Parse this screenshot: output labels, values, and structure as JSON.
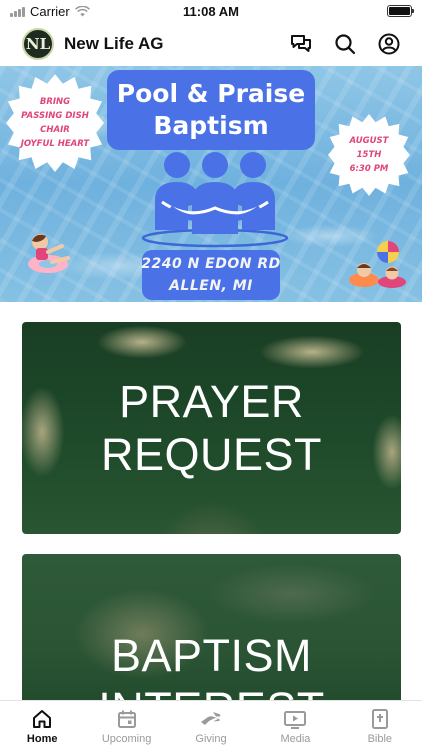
{
  "status_bar": {
    "carrier": "Carrier",
    "time": "11:08 AM"
  },
  "header": {
    "logo_text": "NL",
    "title": "New Life AG",
    "icons": [
      "chat-icon",
      "search-icon",
      "account-icon"
    ]
  },
  "banner": {
    "title_line1": "Pool & Praise",
    "title_line2": "Baptism",
    "bring_items": [
      "BRING",
      "PASSING DISH",
      "CHAIR",
      "JOYFUL HEART"
    ],
    "date_lines": [
      "AUGUST",
      "15TH",
      "6:30 PM"
    ],
    "address_line1": "2240 N EDON RD",
    "address_line2": "ALLEN, MI",
    "colors": {
      "title_box": "#4a72e6",
      "accent_text": "#e0457b"
    }
  },
  "cards": [
    {
      "lines": [
        "PRAYER",
        "REQUEST"
      ]
    },
    {
      "lines": [
        "BAPTISM",
        "INTEREST"
      ]
    }
  ],
  "tab_bar": {
    "items": [
      {
        "label": "Home",
        "icon": "home-icon",
        "active": true
      },
      {
        "label": "Upcoming",
        "icon": "calendar-icon",
        "active": false
      },
      {
        "label": "Giving",
        "icon": "giving-hand-icon",
        "active": false
      },
      {
        "label": "Media",
        "icon": "media-play-icon",
        "active": false
      },
      {
        "label": "Bible",
        "icon": "bible-icon",
        "active": false
      }
    ]
  }
}
